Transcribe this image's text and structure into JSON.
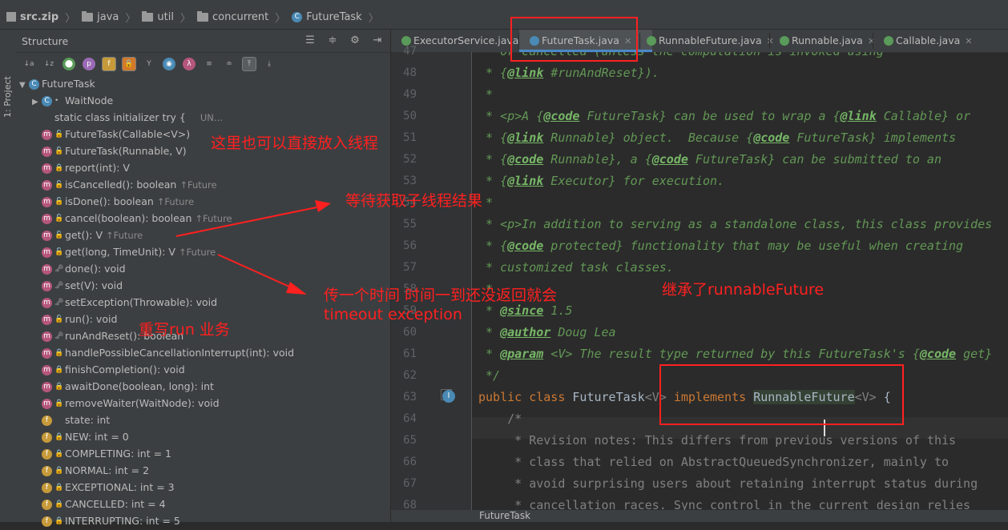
{
  "breadcrumb": [
    "src.zip",
    "java",
    "util",
    "concurrent",
    "FutureTask"
  ],
  "structure": {
    "title": "Structure",
    "project_label": "1: Project",
    "root": "FutureTask",
    "items": [
      {
        "text": "WaitNode",
        "kind": "class",
        "acc": "",
        "up": "",
        "extra": ""
      },
      {
        "text": "static class initializer  try {",
        "kind": "none",
        "acc": "",
        "up": "",
        "extra": "UN..."
      },
      {
        "text": "FutureTask(Callable<V>)",
        "kind": "m",
        "acc": "public",
        "up": "",
        "extra": ""
      },
      {
        "text": "FutureTask(Runnable, V)",
        "kind": "m",
        "acc": "public",
        "up": "",
        "extra": ""
      },
      {
        "text": "report(int): V",
        "kind": "m",
        "acc": "private",
        "up": "",
        "extra": ""
      },
      {
        "text": "isCancelled(): boolean ",
        "kind": "m",
        "acc": "public",
        "up": "↑Future",
        "extra": ""
      },
      {
        "text": "isDone(): boolean ",
        "kind": "m",
        "acc": "public",
        "up": "↑Future",
        "extra": ""
      },
      {
        "text": "cancel(boolean): boolean ",
        "kind": "m",
        "acc": "public",
        "up": "↑Future",
        "extra": ""
      },
      {
        "text": "get(): V ",
        "kind": "m",
        "acc": "public",
        "up": "↑Future",
        "extra": ""
      },
      {
        "text": "get(long, TimeUnit): V ",
        "kind": "m",
        "acc": "public",
        "up": "↑Future",
        "extra": ""
      },
      {
        "text": "done(): void",
        "kind": "m",
        "acc": "protected",
        "up": "",
        "extra": ""
      },
      {
        "text": "set(V): void",
        "kind": "m",
        "acc": "protected",
        "up": "",
        "extra": ""
      },
      {
        "text": "setException(Throwable): void",
        "kind": "m",
        "acc": "protected",
        "up": "",
        "extra": ""
      },
      {
        "text": "run(): void",
        "kind": "m",
        "acc": "public",
        "up": "",
        "extra": ""
      },
      {
        "text": "runAndReset(): boolean",
        "kind": "m",
        "acc": "protected",
        "up": "",
        "extra": ""
      },
      {
        "text": "handlePossibleCancellationInterrupt(int): void",
        "kind": "m",
        "acc": "private",
        "up": "",
        "extra": ""
      },
      {
        "text": "finishCompletion(): void",
        "kind": "m",
        "acc": "private",
        "up": "",
        "extra": ""
      },
      {
        "text": "awaitDone(boolean, long): int",
        "kind": "m",
        "acc": "private",
        "up": "",
        "extra": ""
      },
      {
        "text": "removeWaiter(WaitNode): void",
        "kind": "m",
        "acc": "private",
        "up": "",
        "extra": ""
      },
      {
        "text": "state: int",
        "kind": "f",
        "acc": "",
        "up": "",
        "extra": ""
      },
      {
        "text": "NEW: int = 0",
        "kind": "f",
        "acc": "private",
        "up": "",
        "extra": ""
      },
      {
        "text": "COMPLETING: int = 1",
        "kind": "f",
        "acc": "private",
        "up": "",
        "extra": ""
      },
      {
        "text": "NORMAL: int = 2",
        "kind": "f",
        "acc": "private",
        "up": "",
        "extra": ""
      },
      {
        "text": "EXCEPTIONAL: int = 3",
        "kind": "f",
        "acc": "private",
        "up": "",
        "extra": ""
      },
      {
        "text": "CANCELLED: int = 4",
        "kind": "f",
        "acc": "private",
        "up": "",
        "extra": ""
      },
      {
        "text": "INTERRUPTING: int = 5",
        "kind": "f",
        "acc": "private",
        "up": "",
        "extra": ""
      }
    ]
  },
  "tabs": [
    {
      "label": "ExecutorService.java",
      "active": false,
      "icon": "interface"
    },
    {
      "label": "FutureTask.java",
      "active": true,
      "icon": "class"
    },
    {
      "label": "RunnableFuture.java",
      "active": false,
      "icon": "interface"
    },
    {
      "label": "Runnable.java",
      "active": false,
      "icon": "interface"
    },
    {
      "label": "Callable.java",
      "active": false,
      "icon": "interface"
    }
  ],
  "line_numbers": [
    "47",
    "48",
    "49",
    "50",
    "51",
    "52",
    "53",
    "54",
    "55",
    "56",
    "57",
    "58",
    "59",
    "60",
    "61",
    "62",
    "63",
    "64",
    "65",
    "66",
    "67",
    "68"
  ],
  "code_lines": [
    [
      [
        "cm",
        " * or cancelled (unless the computation is invoked using"
      ]
    ],
    [
      [
        "cm",
        " * {"
      ],
      [
        "tg",
        "@link"
      ],
      [
        "cm",
        " #runAndReset})."
      ]
    ],
    [
      [
        "cm",
        " *"
      ]
    ],
    [
      [
        "cm",
        " * <p>A {"
      ],
      [
        "tg",
        "@code"
      ],
      [
        "cm",
        " FutureTask} can be used to wrap a {"
      ],
      [
        "tg",
        "@link"
      ],
      [
        "cm",
        " Callable} or"
      ]
    ],
    [
      [
        "cm",
        " * {"
      ],
      [
        "tg",
        "@link"
      ],
      [
        "cm",
        " Runnable} object.  Because {"
      ],
      [
        "tg",
        "@code"
      ],
      [
        "cm",
        " FutureTask} implements"
      ]
    ],
    [
      [
        "cm",
        " * {"
      ],
      [
        "tg",
        "@code"
      ],
      [
        "cm",
        " Runnable}, a {"
      ],
      [
        "tg",
        "@code"
      ],
      [
        "cm",
        " FutureTask} can be submitted to an"
      ]
    ],
    [
      [
        "cm",
        " * {"
      ],
      [
        "tg",
        "@link"
      ],
      [
        "cm",
        " Executor} for execution."
      ]
    ],
    [
      [
        "cm",
        " *"
      ]
    ],
    [
      [
        "cm",
        " * <p>In addition to serving as a standalone class, this class provides"
      ]
    ],
    [
      [
        "cm",
        " * {"
      ],
      [
        "tg",
        "@code"
      ],
      [
        "cm",
        " protected} functionality that may be useful when creating"
      ]
    ],
    [
      [
        "cm",
        " * customized task classes."
      ]
    ],
    [
      [
        "cm",
        " *"
      ]
    ],
    [
      [
        "cm",
        " * "
      ],
      [
        "tg",
        "@since"
      ],
      [
        "cm",
        " 1.5"
      ]
    ],
    [
      [
        "cm",
        " * "
      ],
      [
        "tg",
        "@author"
      ],
      [
        "cm",
        " Doug Lea"
      ]
    ],
    [
      [
        "cm",
        " * "
      ],
      [
        "tg",
        "@param"
      ],
      [
        "cm",
        " <V> The result type returned by this FutureTask's {"
      ],
      [
        "tg",
        "@code"
      ],
      [
        "cm",
        " get} "
      ]
    ],
    [
      [
        "cm",
        " */"
      ]
    ],
    [
      [
        "kw",
        "public class "
      ],
      [
        "pl",
        "FutureTask"
      ],
      [
        "cm2",
        "<V>"
      ],
      [
        "kw",
        " implements "
      ],
      [
        "hl",
        "RunnableFuture"
      ],
      [
        "cm2",
        "<V>"
      ],
      [
        "pl",
        " {"
      ]
    ],
    [
      [
        "cm2",
        "    /*"
      ]
    ],
    [
      [
        "cm2",
        "     * Revision notes: This differs from previous versions of this"
      ]
    ],
    [
      [
        "cm2",
        "     * class that relied on AbstractQueuedSynchronizer, mainly to"
      ]
    ],
    [
      [
        "cm2",
        "     * avoid surprising users about retaining interrupt status during"
      ]
    ],
    [
      [
        "cm2",
        "     * cancellation races. Sync control in the current design relies"
      ]
    ]
  ],
  "status": {
    "breadcrumb_text": "FutureTask"
  },
  "annotations": {
    "note_constructor": "这里也可以直接放入线程",
    "note_get": "等待获取子线程结果",
    "note_timeout_1": "传一个时间  时间一到还没返回就会",
    "note_timeout_2": "timeout exception",
    "note_run": "重写run  业务",
    "note_inherit": "继承了runnableFuture"
  },
  "colors": {
    "annotation": "#ff2020",
    "comment": "#629755",
    "keyword": "#cc7832"
  }
}
